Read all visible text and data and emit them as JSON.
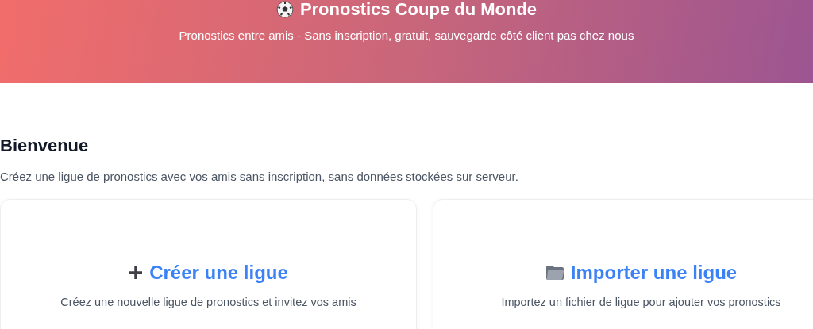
{
  "header": {
    "title": "Pronostics Coupe du Monde",
    "subtitle": "Pronostics entre amis - Sans inscription, gratuit, sauvegarde côté client pas chez nous"
  },
  "welcome": {
    "heading": "Bienvenue",
    "text": "Créez une ligue de pronostics avec vos amis sans inscription, sans données stockées sur serveur."
  },
  "cards": [
    {
      "kind": "create",
      "title": "Créer une ligue",
      "description": "Créez une nouvelle ligue de pronostics et invitez vos amis"
    },
    {
      "kind": "import",
      "title": "Importer une ligue",
      "description": "Importez un fichier de ligue pour ajouter vos pronostics"
    }
  ]
}
